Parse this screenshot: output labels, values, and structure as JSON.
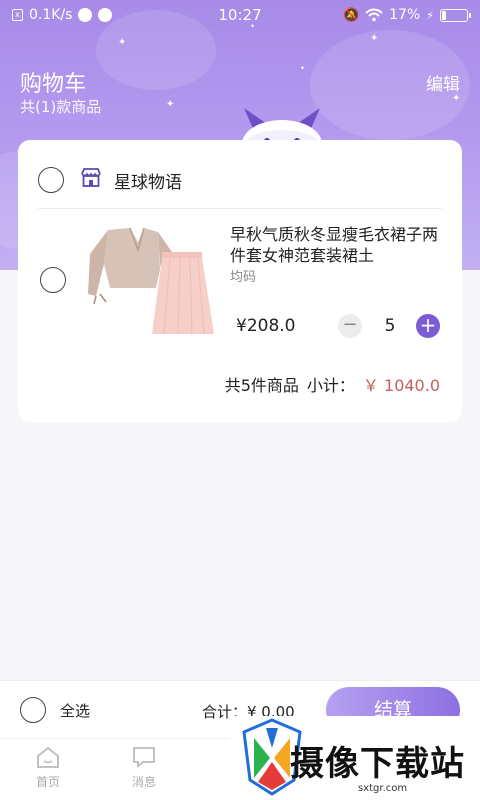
{
  "status_bar": {
    "network_speed": "0.1K/s",
    "time": "10:27",
    "battery": "17%",
    "battery_level": 0.17
  },
  "header": {
    "title": "购物车",
    "subtitle": "共(1)款商品",
    "edit_label": "编辑"
  },
  "store": {
    "name": "星球物语"
  },
  "product": {
    "title": "早秋气质秋冬显瘦毛衣裙子两件套女神范套装裙土",
    "spec": "均码",
    "price": "¥208.0",
    "quantity": "5",
    "minus_label": "−",
    "plus_label": "+"
  },
  "summary": {
    "count_label": "共5件商品",
    "subtotal_label": "小计：",
    "subtotal_amount": "￥ 1040.0"
  },
  "bottom_bar": {
    "select_all_label": "全选",
    "total_label": "合计：¥ 0.00",
    "checkout_label": "结算"
  },
  "tabbar": {
    "tabs": [
      {
        "label": "首页"
      },
      {
        "label": "消息"
      }
    ]
  },
  "watermark": {
    "text": "摄像下载站",
    "url": "sxtgr.com"
  },
  "colors": {
    "accent": "#8d70e2",
    "price_red": "#c0625e",
    "header_gradient_top": "#a88ae8"
  }
}
